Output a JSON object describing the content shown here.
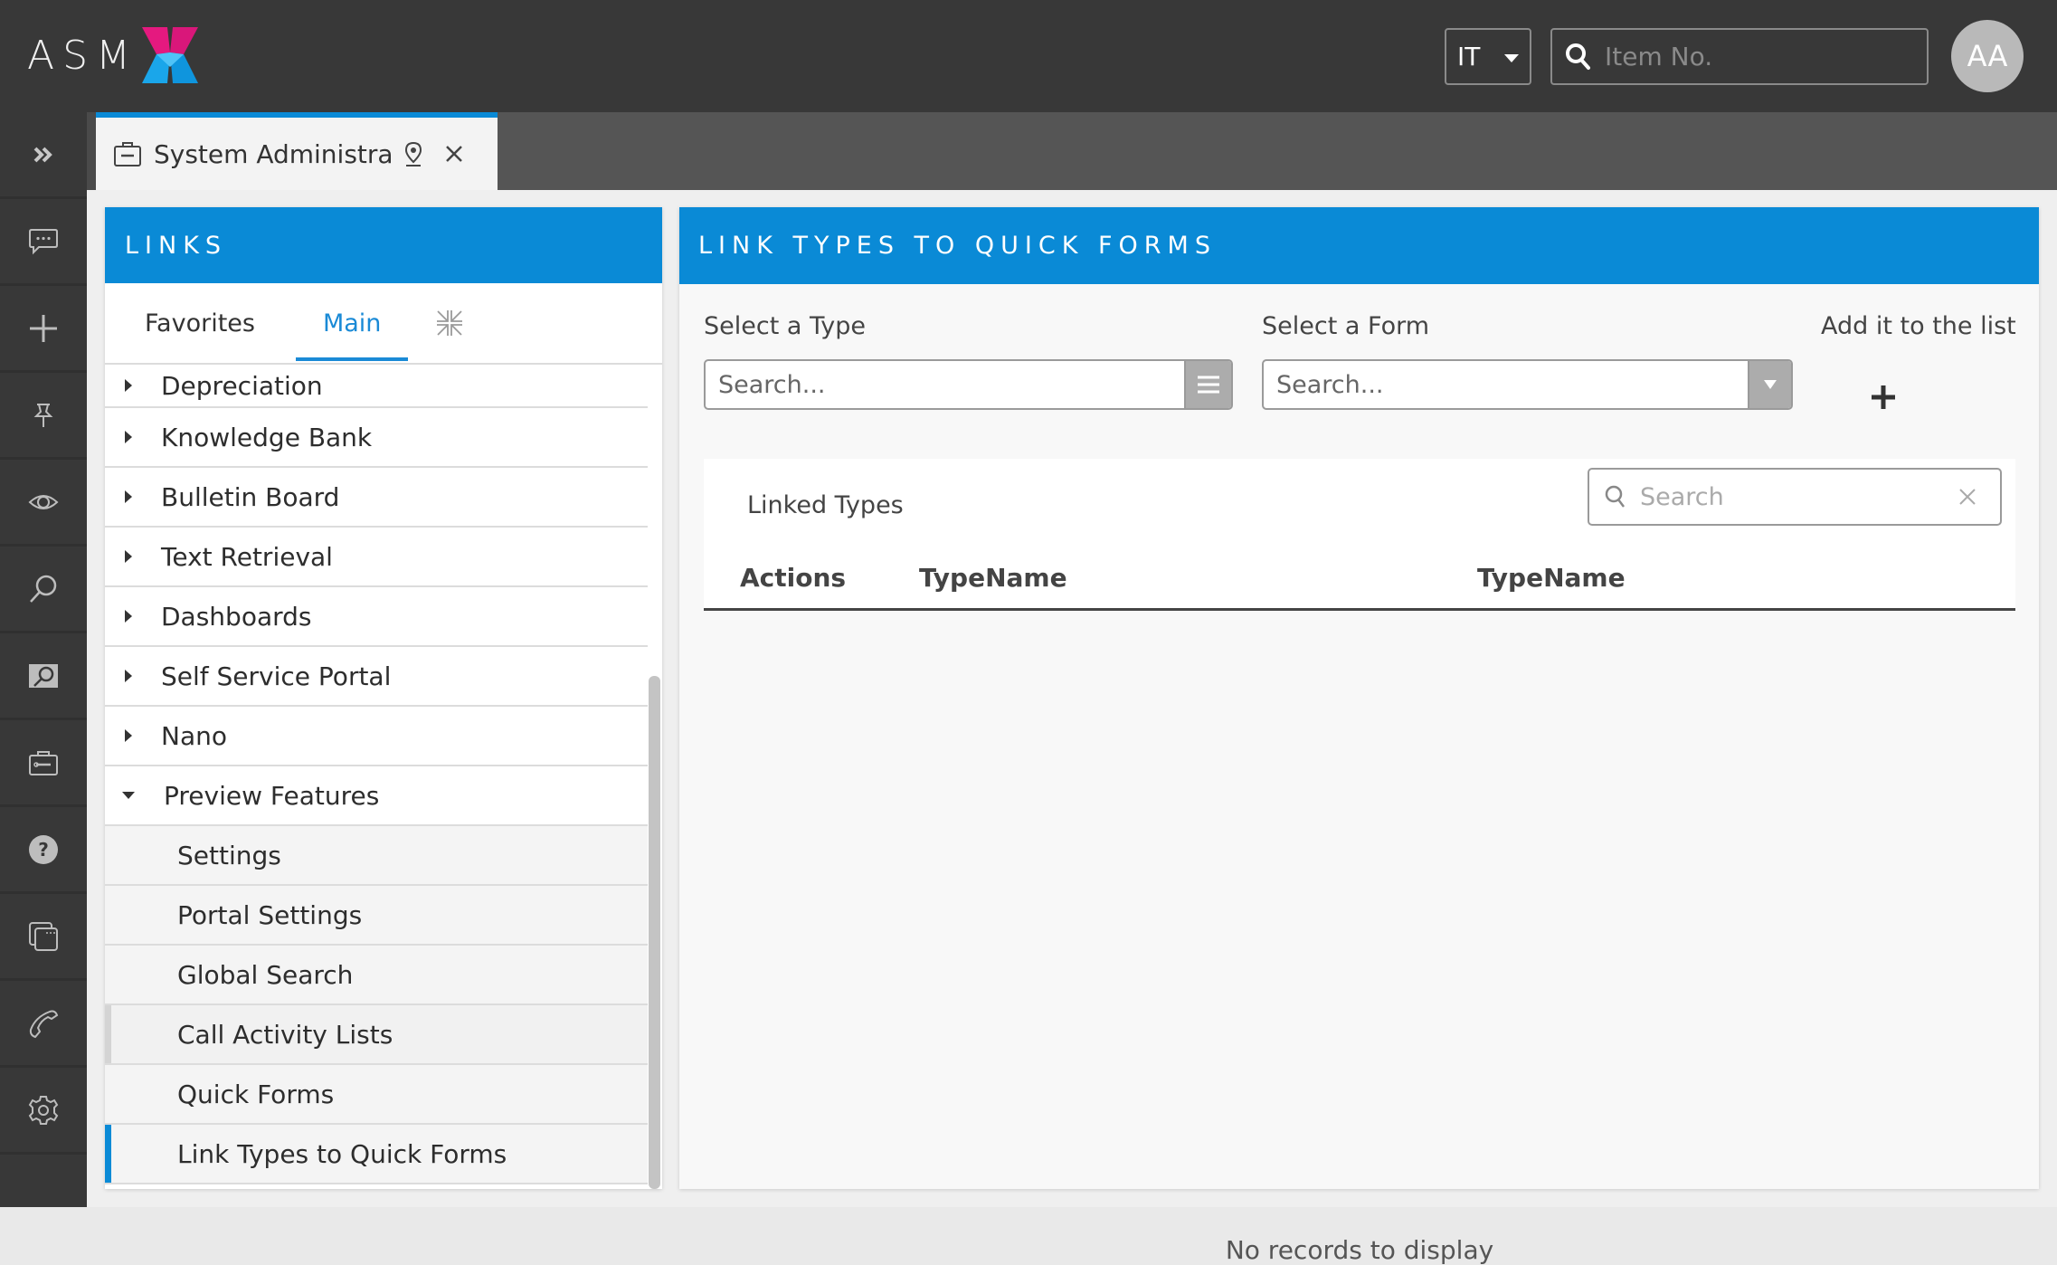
{
  "app": {
    "logo_text": "ASM",
    "brand_colors": {
      "accent": "#0a8ad6",
      "logo_pink": "#e5197f",
      "logo_blue": "#1aa6ea",
      "topbar": "#383838"
    }
  },
  "topbar": {
    "language": "IT",
    "item_search_placeholder": "Item No.",
    "avatar_initials": "AA"
  },
  "rail": {
    "items": [
      {
        "icon": "expand-icon"
      },
      {
        "icon": "chat-icon"
      },
      {
        "icon": "plus-icon"
      },
      {
        "icon": "pin-icon"
      },
      {
        "icon": "eye-icon"
      },
      {
        "icon": "search-icon"
      },
      {
        "icon": "search-box-icon"
      },
      {
        "icon": "toolbox-icon"
      },
      {
        "icon": "help-icon"
      },
      {
        "icon": "windows-icon"
      },
      {
        "icon": "phone-icon"
      },
      {
        "icon": "gear-icon"
      }
    ]
  },
  "tabs": [
    {
      "title": "System Administra...",
      "icon": "toolbox-icon",
      "active": true
    }
  ],
  "links": {
    "header": "LINKS",
    "tabs": {
      "favorites": "Favorites",
      "main": "Main"
    },
    "active_tab": "Main",
    "tree": [
      {
        "label": "Depreciation",
        "expanded": false,
        "level": 0
      },
      {
        "label": "Knowledge Bank",
        "expanded": false,
        "level": 0
      },
      {
        "label": "Bulletin Board",
        "expanded": false,
        "level": 0
      },
      {
        "label": "Text Retrieval",
        "expanded": false,
        "level": 0
      },
      {
        "label": "Dashboards",
        "expanded": false,
        "level": 0
      },
      {
        "label": "Self Service Portal",
        "expanded": false,
        "level": 0
      },
      {
        "label": "Nano",
        "expanded": false,
        "level": 0
      },
      {
        "label": "Preview Features",
        "expanded": true,
        "level": 0
      },
      {
        "label": "Settings",
        "level": 1
      },
      {
        "label": "Portal Settings",
        "level": 1
      },
      {
        "label": "Global Search",
        "level": 1
      },
      {
        "label": "Call Activity Lists",
        "level": 1,
        "hover": true
      },
      {
        "label": "Quick Forms",
        "level": 1
      },
      {
        "label": "Link Types to Quick Forms",
        "level": 1,
        "active": true
      }
    ]
  },
  "main": {
    "header": "LINK TYPES TO QUICK FORMS",
    "select_type": {
      "label": "Select a Type",
      "placeholder": "Search..."
    },
    "select_form": {
      "label": "Select a Form",
      "placeholder": "Search..."
    },
    "add_label": "Add it to the list",
    "grid": {
      "title": "Linked Types",
      "search_placeholder": "Search",
      "columns": [
        "Actions",
        "TypeName",
        "TypeName"
      ],
      "rows": [],
      "empty_message": "No records to display"
    }
  }
}
